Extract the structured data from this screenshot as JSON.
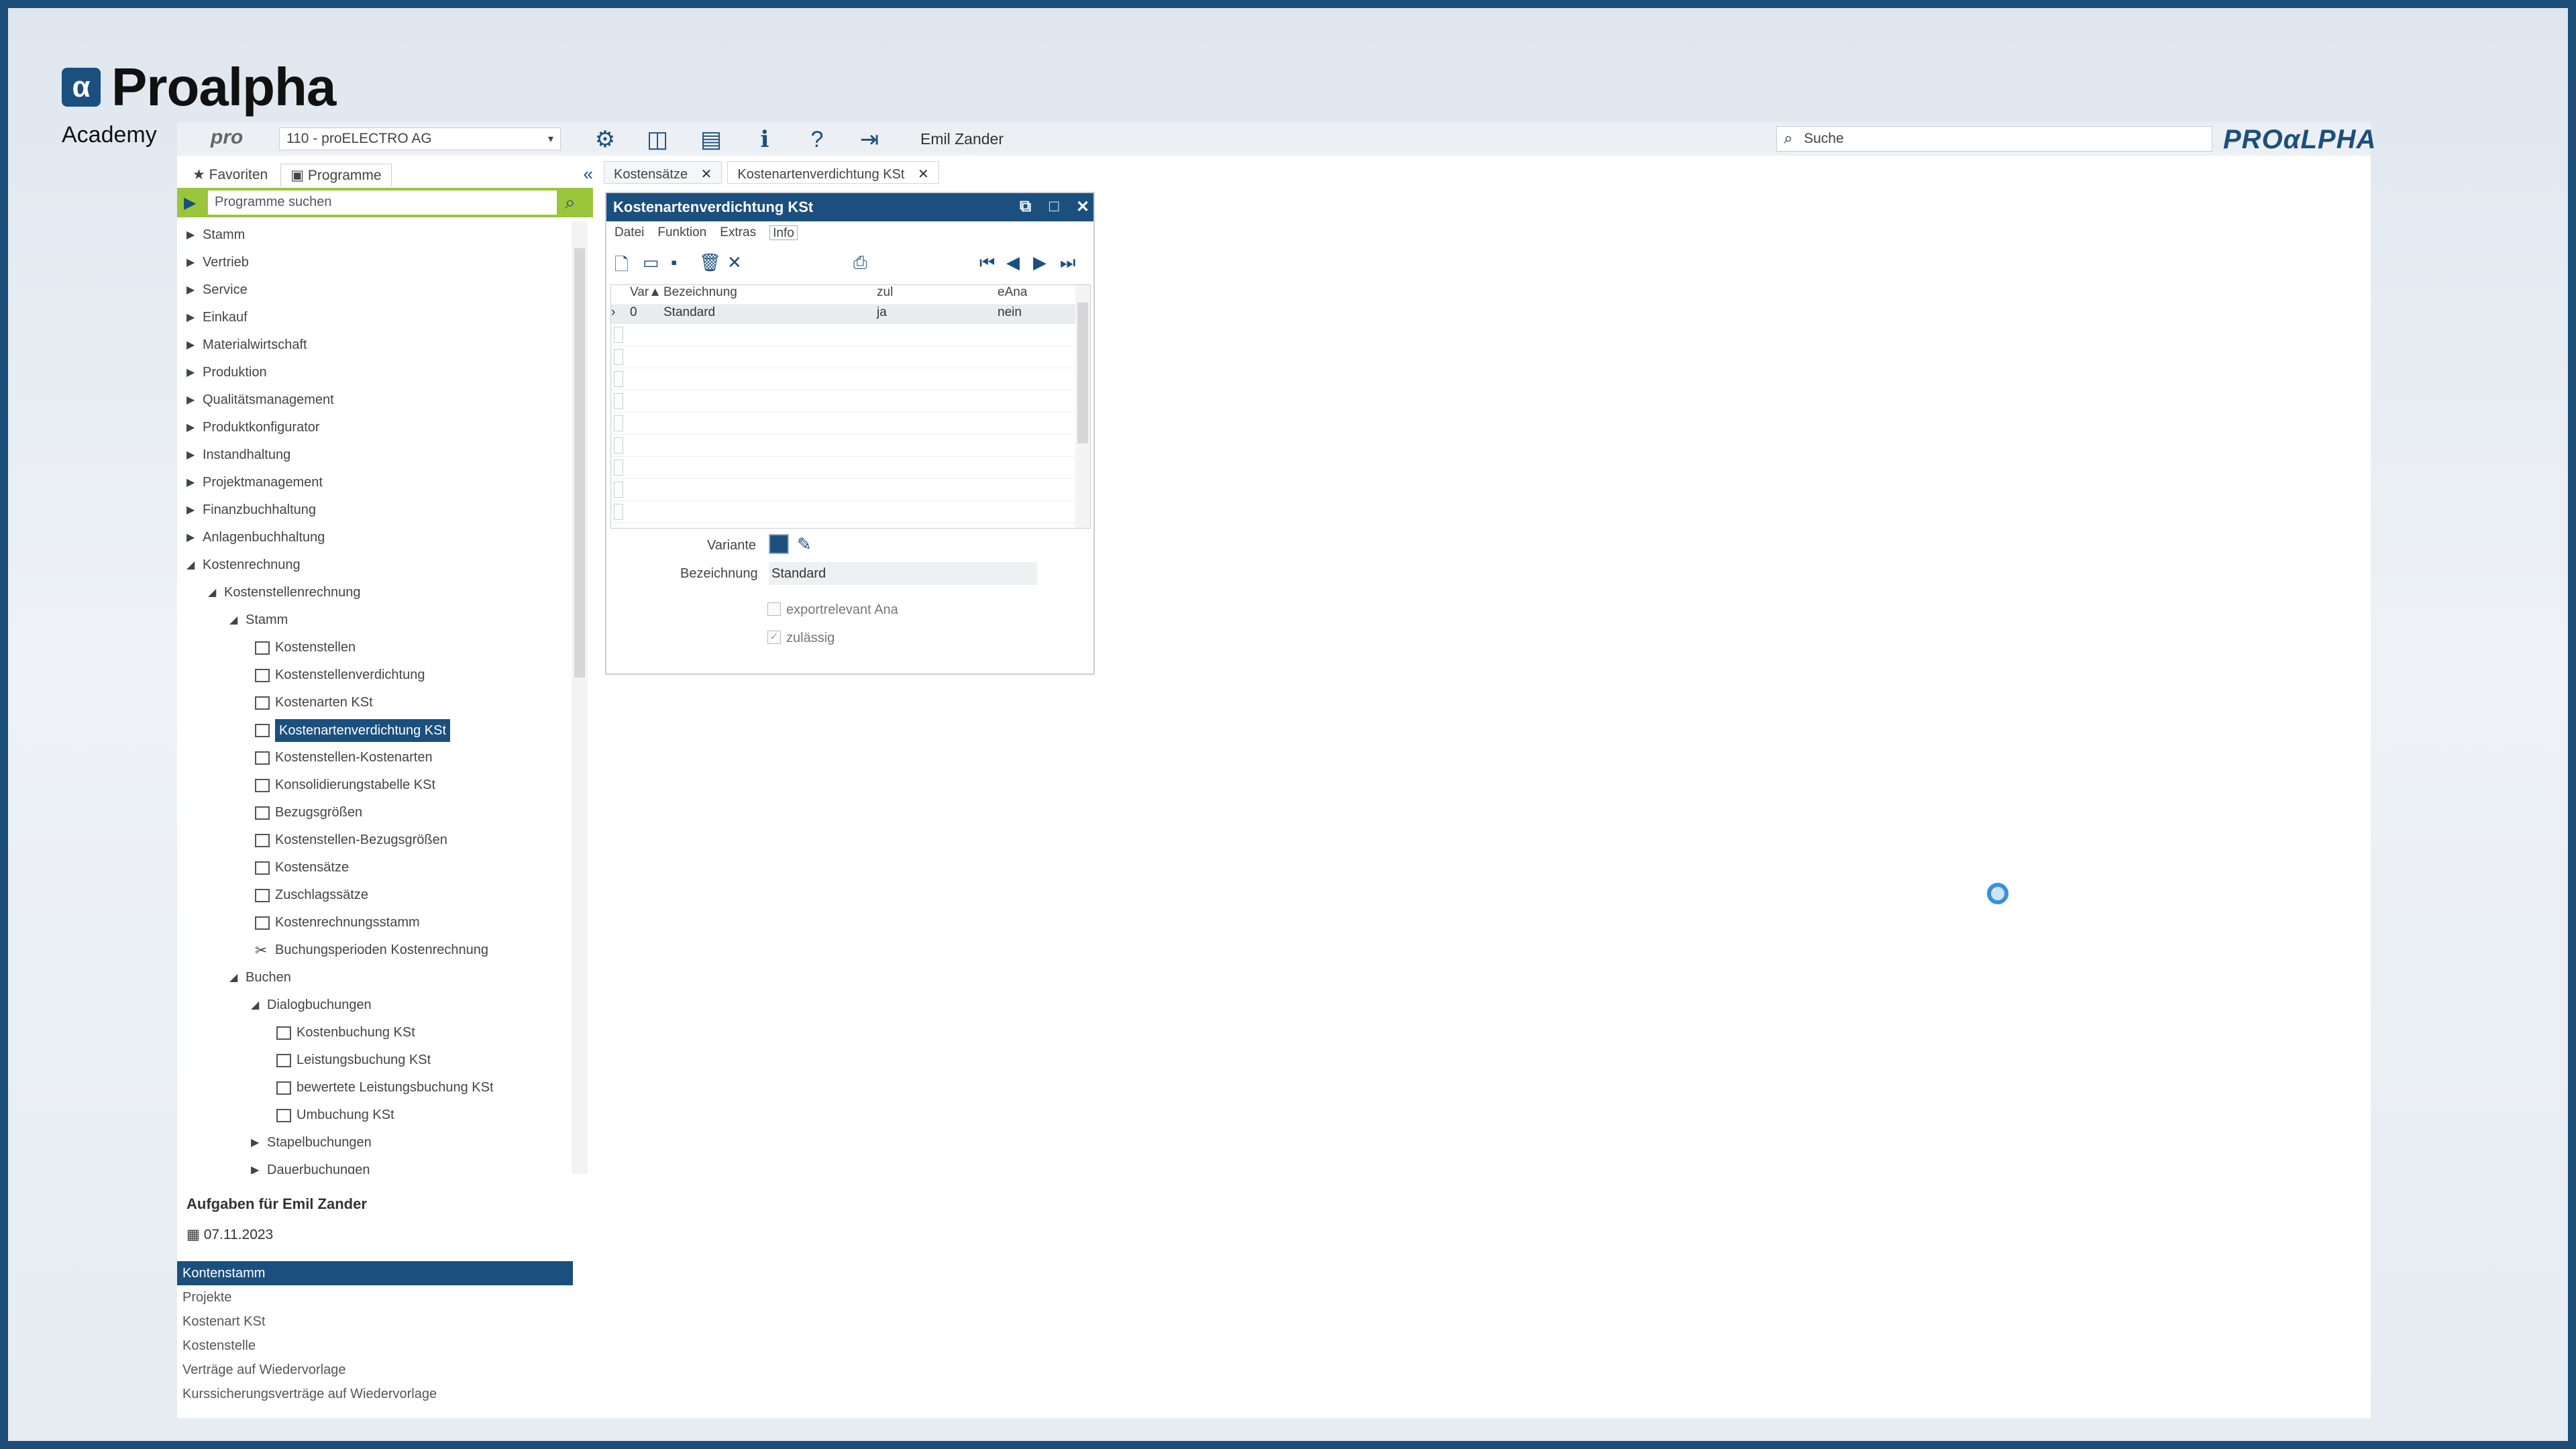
{
  "brand": {
    "name": "Proalpha",
    "sub": "Academy",
    "mark": "α"
  },
  "topbar": {
    "pro_label": "pro",
    "company": "110 - proELECTRO AG",
    "user": "Emil Zander",
    "search_placeholder": "Suche",
    "logo": "PROαLPHA"
  },
  "left_tabs": {
    "favorites": "Favoriten",
    "programs": "Programme"
  },
  "program_search": "Programme suchen",
  "tree": [
    {
      "label": "Stamm",
      "level": 0,
      "type": "folder",
      "expanded": false
    },
    {
      "label": "Vertrieb",
      "level": 0,
      "type": "folder",
      "expanded": false
    },
    {
      "label": "Service",
      "level": 0,
      "type": "folder",
      "expanded": false
    },
    {
      "label": "Einkauf",
      "level": 0,
      "type": "folder",
      "expanded": false
    },
    {
      "label": "Materialwirtschaft",
      "level": 0,
      "type": "folder",
      "expanded": false
    },
    {
      "label": "Produktion",
      "level": 0,
      "type": "folder",
      "expanded": false
    },
    {
      "label": "Qualitätsmanagement",
      "level": 0,
      "type": "folder",
      "expanded": false
    },
    {
      "label": "Produktkonfigurator",
      "level": 0,
      "type": "folder",
      "expanded": false
    },
    {
      "label": "Instandhaltung",
      "level": 0,
      "type": "folder",
      "expanded": false
    },
    {
      "label": "Projektmanagement",
      "level": 0,
      "type": "folder",
      "expanded": false
    },
    {
      "label": "Finanzbuchhaltung",
      "level": 0,
      "type": "folder",
      "expanded": false
    },
    {
      "label": "Anlagenbuchhaltung",
      "level": 0,
      "type": "folder",
      "expanded": false
    },
    {
      "label": "Kostenrechnung",
      "level": 0,
      "type": "folder",
      "expanded": true
    },
    {
      "label": "Kostenstellenrechnung",
      "level": 1,
      "type": "folder",
      "expanded": true
    },
    {
      "label": "Stamm",
      "level": 2,
      "type": "folder",
      "expanded": true
    },
    {
      "label": "Kostenstellen",
      "level": 3,
      "type": "doc"
    },
    {
      "label": "Kostenstellenverdichtung",
      "level": 3,
      "type": "doc"
    },
    {
      "label": "Kostenarten KSt",
      "level": 3,
      "type": "doc"
    },
    {
      "label": "Kostenartenverdichtung KSt",
      "level": 3,
      "type": "doc",
      "selected": true
    },
    {
      "label": "Kostenstellen-Kostenarten",
      "level": 3,
      "type": "doc"
    },
    {
      "label": "Konsolidierungstabelle KSt",
      "level": 3,
      "type": "doc"
    },
    {
      "label": "Bezugsgrößen",
      "level": 3,
      "type": "doc"
    },
    {
      "label": "Kostenstellen-Bezugsgrößen",
      "level": 3,
      "type": "doc"
    },
    {
      "label": "Kostensätze",
      "level": 3,
      "type": "doc"
    },
    {
      "label": "Zuschlagssätze",
      "level": 3,
      "type": "doc"
    },
    {
      "label": "Kostenrechnungsstamm",
      "level": 3,
      "type": "doc"
    },
    {
      "label": "Buchungsperioden Kostenrechnung",
      "level": 3,
      "type": "tool"
    },
    {
      "label": "Buchen",
      "level": 2,
      "type": "folder",
      "expanded": true
    },
    {
      "label": "Dialogbuchungen",
      "level": 3,
      "type": "folder",
      "expanded": true
    },
    {
      "label": "Kostenbuchung KSt",
      "level": 4,
      "type": "doc"
    },
    {
      "label": "Leistungsbuchung KSt",
      "level": 4,
      "type": "doc"
    },
    {
      "label": "bewertete Leistungsbuchung KSt",
      "level": 4,
      "type": "doc"
    },
    {
      "label": "Umbuchung KSt",
      "level": 4,
      "type": "doc"
    },
    {
      "label": "Stapelbuchungen",
      "level": 3,
      "type": "folder",
      "expanded": false
    },
    {
      "label": "Dauerbuchungen",
      "level": 3,
      "type": "folder",
      "expanded": false
    }
  ],
  "tasks": {
    "title": "Aufgaben für Emil Zander",
    "date": "07.11.2023",
    "items": [
      {
        "label": "Kontenstamm",
        "selected": true
      },
      {
        "label": "Projekte"
      },
      {
        "label": "Kostenart KSt"
      },
      {
        "label": "Kostenstelle"
      },
      {
        "label": "Verträge auf Wiedervorlage"
      },
      {
        "label": "Kurssicherungsverträge auf Wiedervorlage"
      }
    ]
  },
  "doc_tabs": [
    {
      "label": "Kostensätze"
    },
    {
      "label": "Kostenartenverdichtung KSt"
    }
  ],
  "dialog": {
    "title": "Kostenartenverdichtung KSt",
    "menu": [
      "Datei",
      "Funktion",
      "Extras",
      "Info"
    ],
    "grid": {
      "headers": [
        "Var▲",
        "Bezeichnung",
        "zul",
        "eAna"
      ],
      "rows": [
        {
          "var": "0",
          "bez": "Standard",
          "zul": "ja",
          "eana": "nein"
        }
      ]
    },
    "form": {
      "variante_label": "Variante",
      "variante_value": "0",
      "bezeichnung_label": "Bezeichnung",
      "bezeichnung_value": "Standard",
      "export_label": "exportrelevant Ana",
      "zulaessig_label": "zulässig"
    }
  },
  "colors": {
    "accent": "#1b4f7e",
    "search_green": "#9bc63c"
  }
}
